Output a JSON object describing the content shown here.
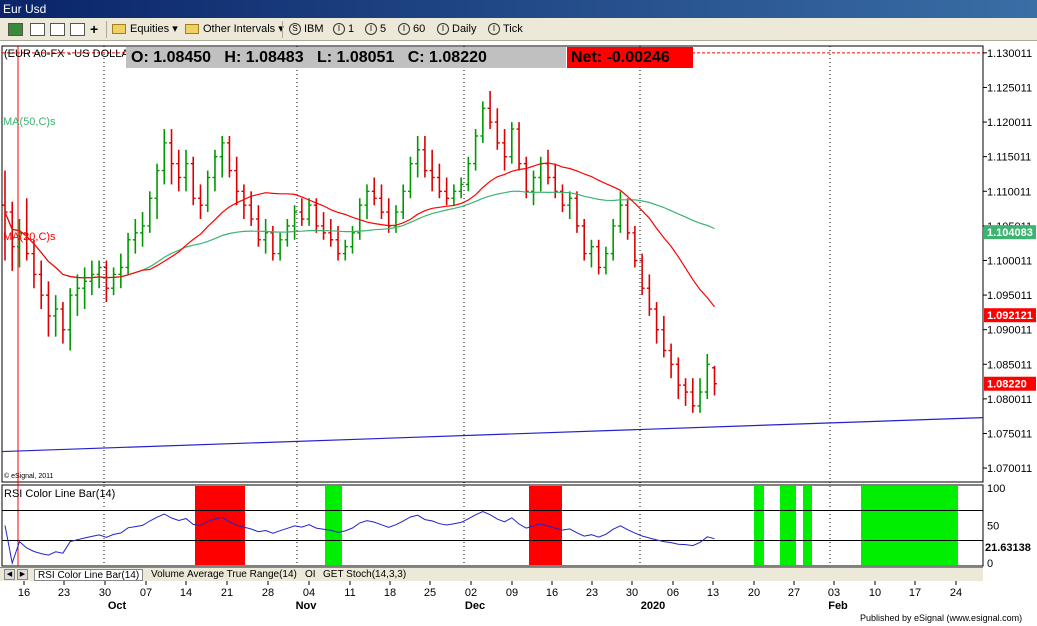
{
  "window": {
    "title": "Eur Usd"
  },
  "toolbar": {
    "equities": "Equities",
    "other_intervals": "Other Intervals",
    "ibm": "IBM",
    "i1": "1",
    "i5": "5",
    "i60": "60",
    "daily": "Daily",
    "tick": "Tick",
    "sym_ibm": "S",
    "sym_i": "I"
  },
  "header": {
    "symbol": "(EUR A0-FX - US DOLLAR",
    "open_label": "O:",
    "open": "1.08450",
    "high_label": "H:",
    "high": "1.08483",
    "low_label": "L:",
    "low": "1.08051",
    "close_label": "C:",
    "close": "1.08220",
    "net_label": "Net:",
    "net": "-0.00246"
  },
  "labels": {
    "ma50": "MA(50,C)s",
    "ma20": "MA(20,C)s",
    "copyright": "© eSignal, 2011",
    "rsi_title": "RSI Color Line Bar(14)",
    "footer": "Published by eSignal (www.esignal.com)"
  },
  "price_axis": {
    "ticks": [
      "1.130011",
      "1.125011",
      "1.120011",
      "1.115011",
      "1.110011",
      "1.105011",
      "1.100011",
      "1.095011",
      "1.090011",
      "1.085011",
      "1.080011",
      "1.075011",
      "1.070011"
    ],
    "tag_ma50": "1.104083",
    "tag_ma20": "1.092121",
    "tag_close": "1.08220",
    "colors": {
      "ma50": "#3cb371",
      "ma20": "#ff0000",
      "close": "#ff0000"
    }
  },
  "rsi_axis": {
    "ticks": [
      "100",
      "50",
      "0"
    ],
    "value": "21.63138"
  },
  "date_axis": {
    "days": [
      "16",
      "23",
      "30",
      "07",
      "14",
      "21",
      "28",
      "04",
      "11",
      "18",
      "25",
      "02",
      "09",
      "16",
      "23",
      "30",
      "06",
      "13",
      "20",
      "27",
      "03",
      "10",
      "17",
      "24"
    ],
    "months": [
      "Oct",
      "Nov",
      "Dec",
      "2020",
      "Feb"
    ]
  },
  "tabs": [
    "RSI Color Line Bar(14)",
    "Volume",
    "Average True Range(14)",
    "OI",
    "GET Stoch(14,3,3)"
  ],
  "chart_data": {
    "type": "bar",
    "ylim": [
      1.068,
      1.131
    ],
    "bars": [
      [
        1.108,
        1.113,
        1.1,
        1.107
      ],
      [
        1.107,
        1.1085,
        1.0985,
        1.102
      ],
      [
        1.102,
        1.106,
        1.099,
        1.104
      ],
      [
        1.104,
        1.109,
        1.1,
        1.101
      ],
      [
        1.101,
        1.103,
        1.096,
        1.098
      ],
      [
        1.098,
        1.1,
        1.093,
        1.095
      ],
      [
        1.095,
        1.097,
        1.089,
        1.092
      ],
      [
        1.092,
        1.095,
        1.089,
        1.093
      ],
      [
        1.093,
        1.094,
        1.088,
        1.09
      ],
      [
        1.09,
        1.096,
        1.087,
        1.095
      ],
      [
        1.095,
        1.098,
        1.092,
        1.096
      ],
      [
        1.096,
        1.099,
        1.093,
        1.097
      ],
      [
        1.097,
        1.1,
        1.095,
        1.098
      ],
      [
        1.098,
        1.1,
        1.096,
        1.099
      ],
      [
        1.099,
        1.1,
        1.094,
        1.096
      ],
      [
        1.096,
        1.099,
        1.095,
        1.098
      ],
      [
        1.098,
        1.101,
        1.096,
        1.099
      ],
      [
        1.099,
        1.104,
        1.098,
        1.103
      ],
      [
        1.103,
        1.106,
        1.101,
        1.104
      ],
      [
        1.104,
        1.107,
        1.102,
        1.105
      ],
      [
        1.105,
        1.11,
        1.104,
        1.109
      ],
      [
        1.109,
        1.114,
        1.106,
        1.113
      ],
      [
        1.113,
        1.119,
        1.111,
        1.117
      ],
      [
        1.117,
        1.119,
        1.111,
        1.114
      ],
      [
        1.114,
        1.116,
        1.11,
        1.112
      ],
      [
        1.112,
        1.116,
        1.11,
        1.114
      ],
      [
        1.114,
        1.115,
        1.108,
        1.109
      ],
      [
        1.109,
        1.111,
        1.106,
        1.108
      ],
      [
        1.108,
        1.113,
        1.107,
        1.112
      ],
      [
        1.112,
        1.116,
        1.11,
        1.115
      ],
      [
        1.115,
        1.118,
        1.112,
        1.117
      ],
      [
        1.117,
        1.118,
        1.112,
        1.113
      ],
      [
        1.113,
        1.115,
        1.108,
        1.11
      ],
      [
        1.11,
        1.111,
        1.106,
        1.108
      ],
      [
        1.108,
        1.11,
        1.105,
        1.106
      ],
      [
        1.106,
        1.108,
        1.102,
        1.103
      ],
      [
        1.103,
        1.106,
        1.101,
        1.104
      ],
      [
        1.104,
        1.105,
        1.1,
        1.101
      ],
      [
        1.101,
        1.104,
        1.1,
        1.103
      ],
      [
        1.103,
        1.106,
        1.102,
        1.105
      ],
      [
        1.105,
        1.108,
        1.103,
        1.107
      ],
      [
        1.107,
        1.109,
        1.105,
        1.106
      ],
      [
        1.106,
        1.109,
        1.105,
        1.108
      ],
      [
        1.108,
        1.109,
        1.104,
        1.105
      ],
      [
        1.105,
        1.107,
        1.103,
        1.104
      ],
      [
        1.104,
        1.106,
        1.102,
        1.103
      ],
      [
        1.103,
        1.105,
        1.1,
        1.101
      ],
      [
        1.101,
        1.103,
        1.1,
        1.102
      ],
      [
        1.102,
        1.105,
        1.101,
        1.104
      ],
      [
        1.104,
        1.109,
        1.103,
        1.108
      ],
      [
        1.108,
        1.111,
        1.106,
        1.11
      ],
      [
        1.11,
        1.112,
        1.108,
        1.109
      ],
      [
        1.109,
        1.111,
        1.106,
        1.107
      ],
      [
        1.107,
        1.109,
        1.104,
        1.105
      ],
      [
        1.105,
        1.108,
        1.104,
        1.107
      ],
      [
        1.107,
        1.111,
        1.106,
        1.11
      ],
      [
        1.11,
        1.115,
        1.109,
        1.114
      ],
      [
        1.114,
        1.118,
        1.112,
        1.116
      ],
      [
        1.116,
        1.118,
        1.112,
        1.113
      ],
      [
        1.113,
        1.116,
        1.11,
        1.112
      ],
      [
        1.112,
        1.114,
        1.109,
        1.11
      ],
      [
        1.11,
        1.112,
        1.108,
        1.109
      ],
      [
        1.109,
        1.111,
        1.108,
        1.11
      ],
      [
        1.11,
        1.112,
        1.109,
        1.111
      ],
      [
        1.111,
        1.115,
        1.11,
        1.114
      ],
      [
        1.114,
        1.119,
        1.113,
        1.118
      ],
      [
        1.118,
        1.123,
        1.117,
        1.122
      ],
      [
        1.122,
        1.1245,
        1.119,
        1.12
      ],
      [
        1.12,
        1.122,
        1.116,
        1.117
      ],
      [
        1.117,
        1.119,
        1.113,
        1.115
      ],
      [
        1.115,
        1.12,
        1.114,
        1.119
      ],
      [
        1.119,
        1.12,
        1.113,
        1.114
      ],
      [
        1.114,
        1.115,
        1.109,
        1.11
      ],
      [
        1.11,
        1.113,
        1.108,
        1.112
      ],
      [
        1.112,
        1.115,
        1.11,
        1.114
      ],
      [
        1.114,
        1.116,
        1.111,
        1.112
      ],
      [
        1.112,
        1.114,
        1.109,
        1.11
      ],
      [
        1.11,
        1.111,
        1.107,
        1.108
      ],
      [
        1.108,
        1.11,
        1.106,
        1.109
      ],
      [
        1.109,
        1.11,
        1.104,
        1.105
      ],
      [
        1.105,
        1.106,
        1.1,
        1.101
      ],
      [
        1.101,
        1.103,
        1.099,
        1.102
      ],
      [
        1.102,
        1.103,
        1.098,
        1.099
      ],
      [
        1.099,
        1.102,
        1.098,
        1.101
      ],
      [
        1.101,
        1.106,
        1.1,
        1.105
      ],
      [
        1.105,
        1.11,
        1.104,
        1.108
      ],
      [
        1.108,
        1.109,
        1.103,
        1.104
      ],
      [
        1.104,
        1.105,
        1.099,
        1.1
      ],
      [
        1.1,
        1.101,
        1.095,
        1.096
      ],
      [
        1.096,
        1.098,
        1.092,
        1.093
      ],
      [
        1.093,
        1.094,
        1.088,
        1.09
      ],
      [
        1.09,
        1.092,
        1.086,
        1.087
      ],
      [
        1.087,
        1.088,
        1.083,
        1.085
      ],
      [
        1.085,
        1.086,
        1.08,
        1.082
      ],
      [
        1.082,
        1.083,
        1.079,
        1.081
      ],
      [
        1.081,
        1.083,
        1.078,
        1.079
      ],
      [
        1.079,
        1.083,
        1.078,
        1.081
      ],
      [
        1.081,
        1.0865,
        1.08,
        1.085
      ],
      [
        1.0845,
        1.0848,
        1.0805,
        1.0822
      ]
    ]
  }
}
